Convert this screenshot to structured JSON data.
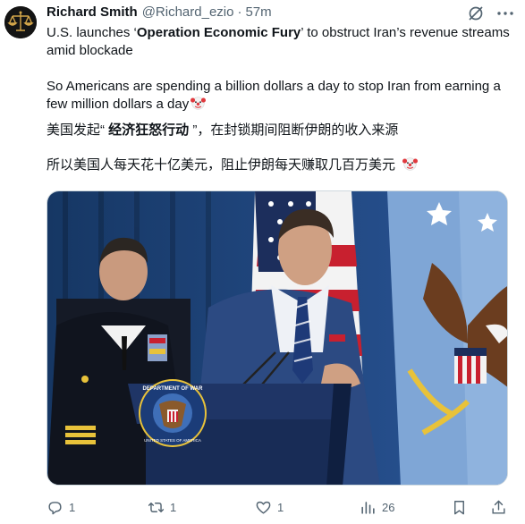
{
  "author": {
    "name": "Richard Smith",
    "handle": "@Richard_ezio",
    "separator": "·",
    "time": "57m"
  },
  "post": {
    "line1_pre": "U.S. launches ‘",
    "line1_bold": "Operation Economic Fury",
    "line1_post": "’ to obstruct Iran’s revenue streams amid blockade",
    "line2": "So Americans are spending a billion dollars a day to stop Iran from earning a few million dollars a day",
    "line3_pre": "美国发起“ ",
    "line3_bold": "经济狂怒行动",
    "line3_post": " ”，在封锁期间阻断伊朗的收入来源",
    "line4": "所以美国人每天花十亿美元，阻止伊朗每天赚取几百万美元"
  },
  "photo": {
    "seal_text_top": "DEPARTMENT OF WAR",
    "seal_text_bottom": "UNITED STATES OF AMERICA"
  },
  "actions": {
    "replies": "1",
    "reposts": "1",
    "likes": "1",
    "views": "26"
  },
  "colors": {
    "text_primary": "#0f1419",
    "text_secondary": "#536471",
    "photo_bg": "#1d3f78",
    "flag_blue": "#7fa6d6"
  },
  "icons": {
    "grok": "grok-icon",
    "more": "more-icon",
    "emoji": "clown-face-emoji",
    "reply": "reply-icon",
    "repost": "repost-icon",
    "like": "heart-icon",
    "views": "views-icon",
    "bookmark": "bookmark-icon",
    "share": "share-icon"
  }
}
